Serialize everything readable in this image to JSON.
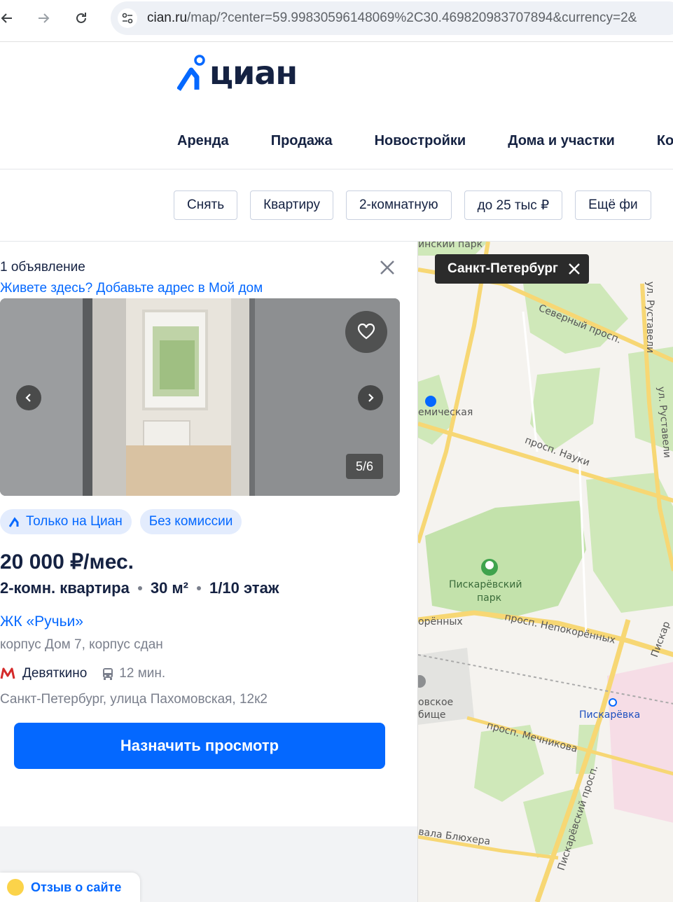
{
  "browser": {
    "url_host": "cian.ru",
    "url_rest": "/map/?center=59.99830596148069%2C30.469820983707894&currency=2&"
  },
  "header": {
    "logo_text": "циан",
    "nav": [
      "Аренда",
      "Продажа",
      "Новостройки",
      "Дома и участки",
      "Ко"
    ]
  },
  "filters": [
    "Снять",
    "Квартиру",
    "2-комнатную",
    "до 25 тыс ₽",
    "Ещё фи"
  ],
  "listing_panel": {
    "count": "1 объявление",
    "add_address_link": "Живете здесь? Добавьте адрес в Мой дом",
    "photo_counter": "5/6",
    "badges": [
      "Только на Циан",
      "Без комиссии"
    ],
    "price": "20 000 ₽/мес.",
    "rooms": "2-комн. квартира",
    "area": "30 м²",
    "floor": "1/10 этаж",
    "complex": "ЖК «Ручьи»",
    "building": "корпус Дом 7, корпус сдан",
    "metro_station": "Девяткино",
    "metro_time": "12 мин.",
    "address": "Санкт-Петербург, улица Пахомовская, 12к2",
    "cta": "Назначить просмотр",
    "feedback": "Отзыв о сайте"
  },
  "map": {
    "city": "Санкт-Петербург",
    "labels": {
      "park_top": "инский парк",
      "severny": "Северный просп.",
      "rustaveli1": "ул. Руставели",
      "rustaveli2": "ул. Руставели",
      "metro_akadem": "емическая",
      "nauki": "просп. Науки",
      "piskar_park1": "Пискарёвский",
      "piskar_park2": "парк",
      "nepokor1": "орённых",
      "nepokor2": "просп. Непокорённых",
      "piskar_v": "Пискар",
      "cemetery1": "овское",
      "cemetery2": "бище",
      "piskarevka": "Пискарёвка",
      "mechnikova": "просп. Мечникова",
      "piskar_prosp": "Пискарёвский просп.",
      "bluhera": "вала Блюхера"
    }
  },
  "colors": {
    "brand": "#0468ff",
    "text_primary": "#152242",
    "text_secondary": "#7a7f8c",
    "metro_red": "#d42a2a"
  }
}
